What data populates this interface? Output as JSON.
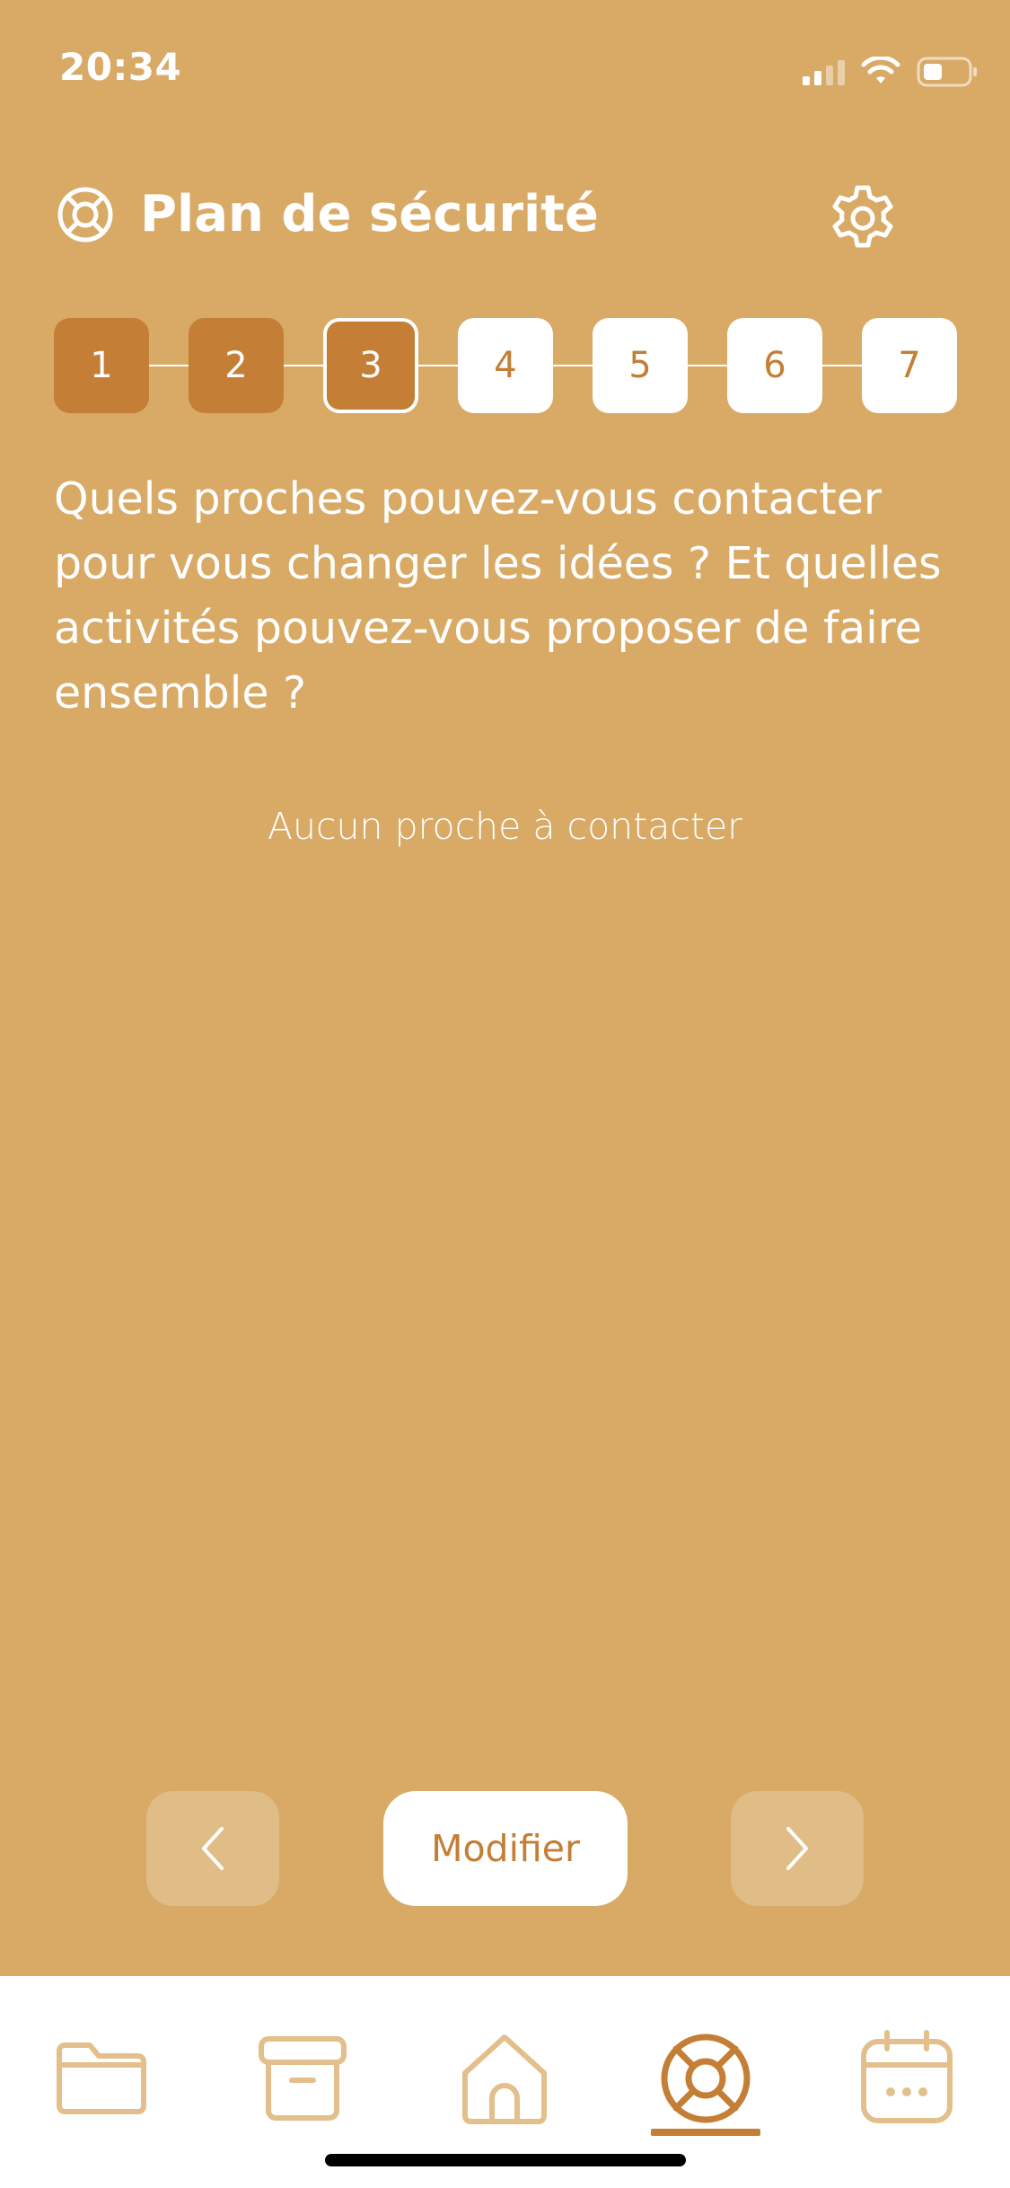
{
  "status_bar": {
    "time": "20:34",
    "icons": [
      "signal-icon",
      "wifi-icon",
      "battery-icon"
    ]
  },
  "header": {
    "title": "Plan de sécurité",
    "icon": "lifebuoy-icon",
    "settings_icon": "gear-icon"
  },
  "stepper": {
    "steps": [
      {
        "label": "1",
        "state": "done"
      },
      {
        "label": "2",
        "state": "done"
      },
      {
        "label": "3",
        "state": "current"
      },
      {
        "label": "4",
        "state": "todo"
      },
      {
        "label": "5",
        "state": "todo"
      },
      {
        "label": "6",
        "state": "todo"
      },
      {
        "label": "7",
        "state": "todo"
      }
    ]
  },
  "content": {
    "question": "Quels proches pouvez-vous contacter pour vous changer les idées ? Et quelles activités pouvez-vous proposer de faire ensemble ?",
    "empty_message": "Aucun proche à contacter"
  },
  "actions": {
    "prev_icon": "chevron-left-icon",
    "modify_label": "Modifier",
    "next_icon": "chevron-right-icon"
  },
  "tabbar": {
    "items": [
      {
        "icon": "folder-icon",
        "active": false
      },
      {
        "icon": "archive-icon",
        "active": false
      },
      {
        "icon": "home-icon",
        "active": false
      },
      {
        "icon": "lifebuoy-icon",
        "active": true
      },
      {
        "icon": "calendar-icon",
        "active": false
      }
    ]
  },
  "colors": {
    "background": "#D8AA66",
    "accent": "#C47E35",
    "inactive_icon": "#E3BF8C",
    "white": "#FFFFFF"
  }
}
